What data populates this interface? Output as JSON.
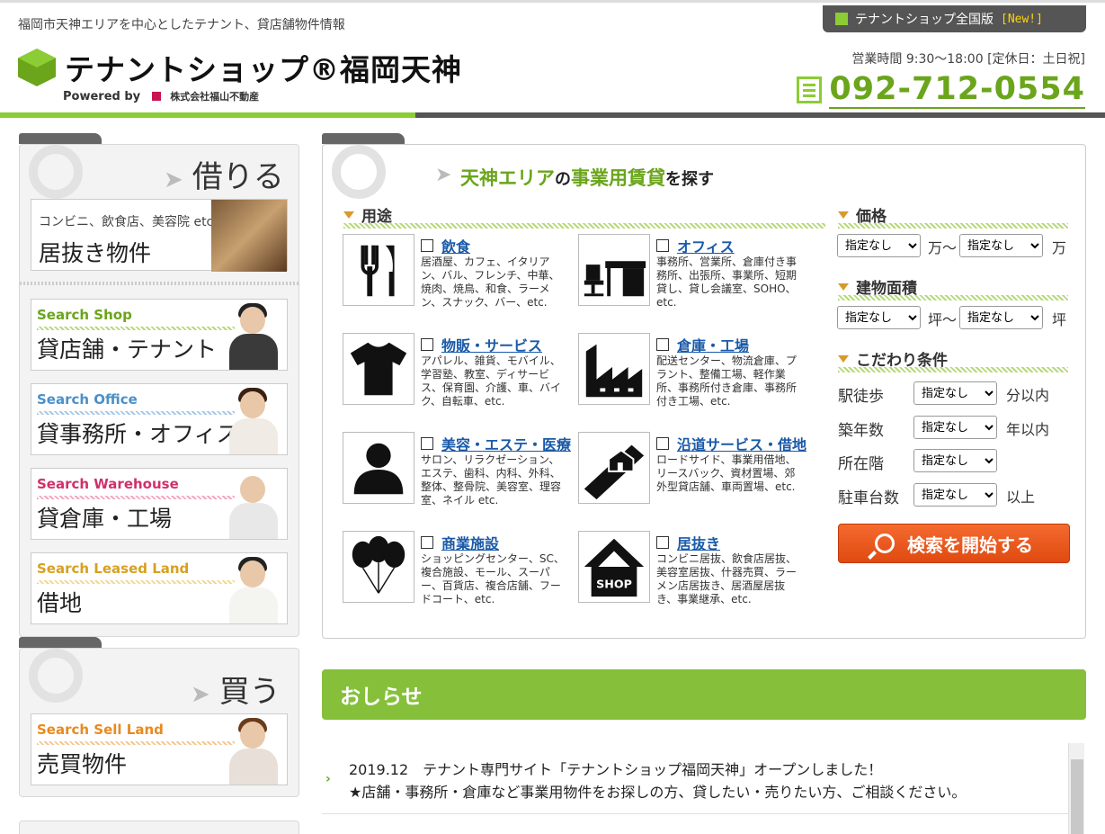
{
  "header": {
    "tagline": "福岡市天神エリアを中心としたテナント、貸店舗物件情報",
    "logo_text": "テナントショップ®福岡天神",
    "powered_by": "Powered by",
    "company": "株式会社福山不動産",
    "national_link": "テナントショップ全国版",
    "new_badge": "[New!]",
    "hours": "営業時間 9:30～18:00 [定休日：土日祝]",
    "phone": "092-712-0554"
  },
  "rent_panel": {
    "heading": "借りる",
    "sub_card": {
      "small": "コンビニ、飲食店、美容院 etc.",
      "label": "居抜き物件"
    },
    "cards": [
      {
        "en": "Search Shop",
        "jp": "貸店舗・テナント",
        "color": "#6aa51b"
      },
      {
        "en": "Search Office",
        "jp": "貸事務所・オフィス",
        "color": "#4a90c8"
      },
      {
        "en": "Search Warehouse",
        "jp": "貸倉庫・工場",
        "color": "#d0306a"
      },
      {
        "en": "Search Leased Land",
        "jp": "借地",
        "color": "#d8a020"
      }
    ]
  },
  "buy_panel": {
    "heading": "買う",
    "card": {
      "en": "Search Sell Land",
      "jp": "売買物件",
      "color": "#e88a20"
    }
  },
  "search": {
    "title_1": "天神エリア",
    "title_2": "の",
    "title_3": "事業用賃貸",
    "title_4": "を探す",
    "usage_label": "用途",
    "categories": [
      {
        "name": "飲食",
        "icon": "fork-knife-icon",
        "desc": "居酒屋、カフェ、イタリアン、バル、フレンチ、中華、焼肉、焼鳥、和食、ラーメン、スナック、バー、etc."
      },
      {
        "name": "オフィス",
        "icon": "office-desk-icon",
        "desc": "事務所、営業所、倉庫付き事務所、出張所、事業所、短期貸し、貸し会議室、SOHO、etc."
      },
      {
        "name": "物販・サービス",
        "icon": "tshirt-icon",
        "desc": "アパレル、雑貨、モバイル、学習塾、教室、ディサービス、保育園、介護、車、バイク、自転車、etc."
      },
      {
        "name": "倉庫・工場",
        "icon": "factory-icon",
        "desc": "配送センター、物流倉庫、プラント、整備工場、軽作業所、事務所付き倉庫、事務所付き工場、etc."
      },
      {
        "name": "美容・エステ・医療",
        "icon": "person-icon",
        "desc": "サロン、リラクゼーション、エステ、歯科、内科、外科、整体、整骨院、美容室、理容室、ネイル etc."
      },
      {
        "name": "沿道サービス・借地",
        "icon": "roadside-house-icon",
        "desc": "ロードサイド、事業用借地、リースバック、資材置場、郊外型貸店舗、車両置場、etc."
      },
      {
        "name": "商業施設",
        "icon": "balloons-icon",
        "desc": "ショッピングセンター、SC、複合施設、モール、スーパー、百貨店、複合店舗、フードコート、etc."
      },
      {
        "name": "居抜き",
        "icon": "shop-house-icon",
        "desc": "コンビニ居抜、飲食店居抜、美容室居抜、什器売買、ラーメン店居抜き、居酒屋居抜き、事業継承、etc."
      }
    ],
    "price_label": "価格",
    "price_unit_from": "万～",
    "price_unit_to": "万",
    "area_label": "建物面積",
    "area_unit_from": "坪～",
    "area_unit_to": "坪",
    "cond_label": "こだわり条件",
    "select_default": "指定なし",
    "conditions": [
      {
        "label": "駅徒歩",
        "unit": "分以内"
      },
      {
        "label": "築年数",
        "unit": "年以内"
      },
      {
        "label": "所在階",
        "unit": ""
      },
      {
        "label": "駐車台数",
        "unit": "以上"
      }
    ],
    "search_button": "検索を開始する"
  },
  "news": {
    "heading": "おしらせ",
    "items": [
      {
        "line1": "2019.12　テナント専門サイト「テナントショップ福岡天神」オープンしました！",
        "line2": "★店舗・事務所・倉庫など事業用物件をお探しの方、貸したい・売りたい方、ご相談ください。"
      }
    ]
  }
}
